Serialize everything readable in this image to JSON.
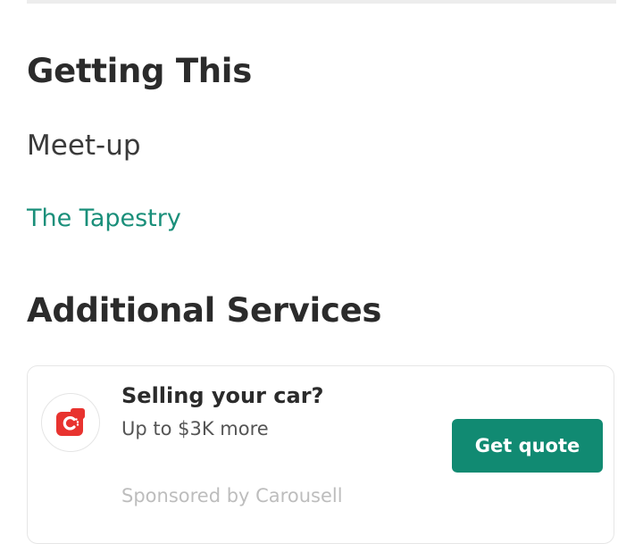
{
  "getting": {
    "title": "Getting This",
    "method": "Meet-up",
    "location": "The Tapestry"
  },
  "services": {
    "title": "Additional Services",
    "card": {
      "logo_icon": "carousell-logo-icon",
      "brand_color": "#e8332f",
      "title": "Selling your car?",
      "subtitle": "Up to $3K more",
      "button_label": "Get quote",
      "button_color": "#118a72",
      "sponsor_text": "Sponsored by Carousell"
    }
  },
  "colors": {
    "link": "#1a8f7a",
    "text": "#2b2b2b"
  }
}
